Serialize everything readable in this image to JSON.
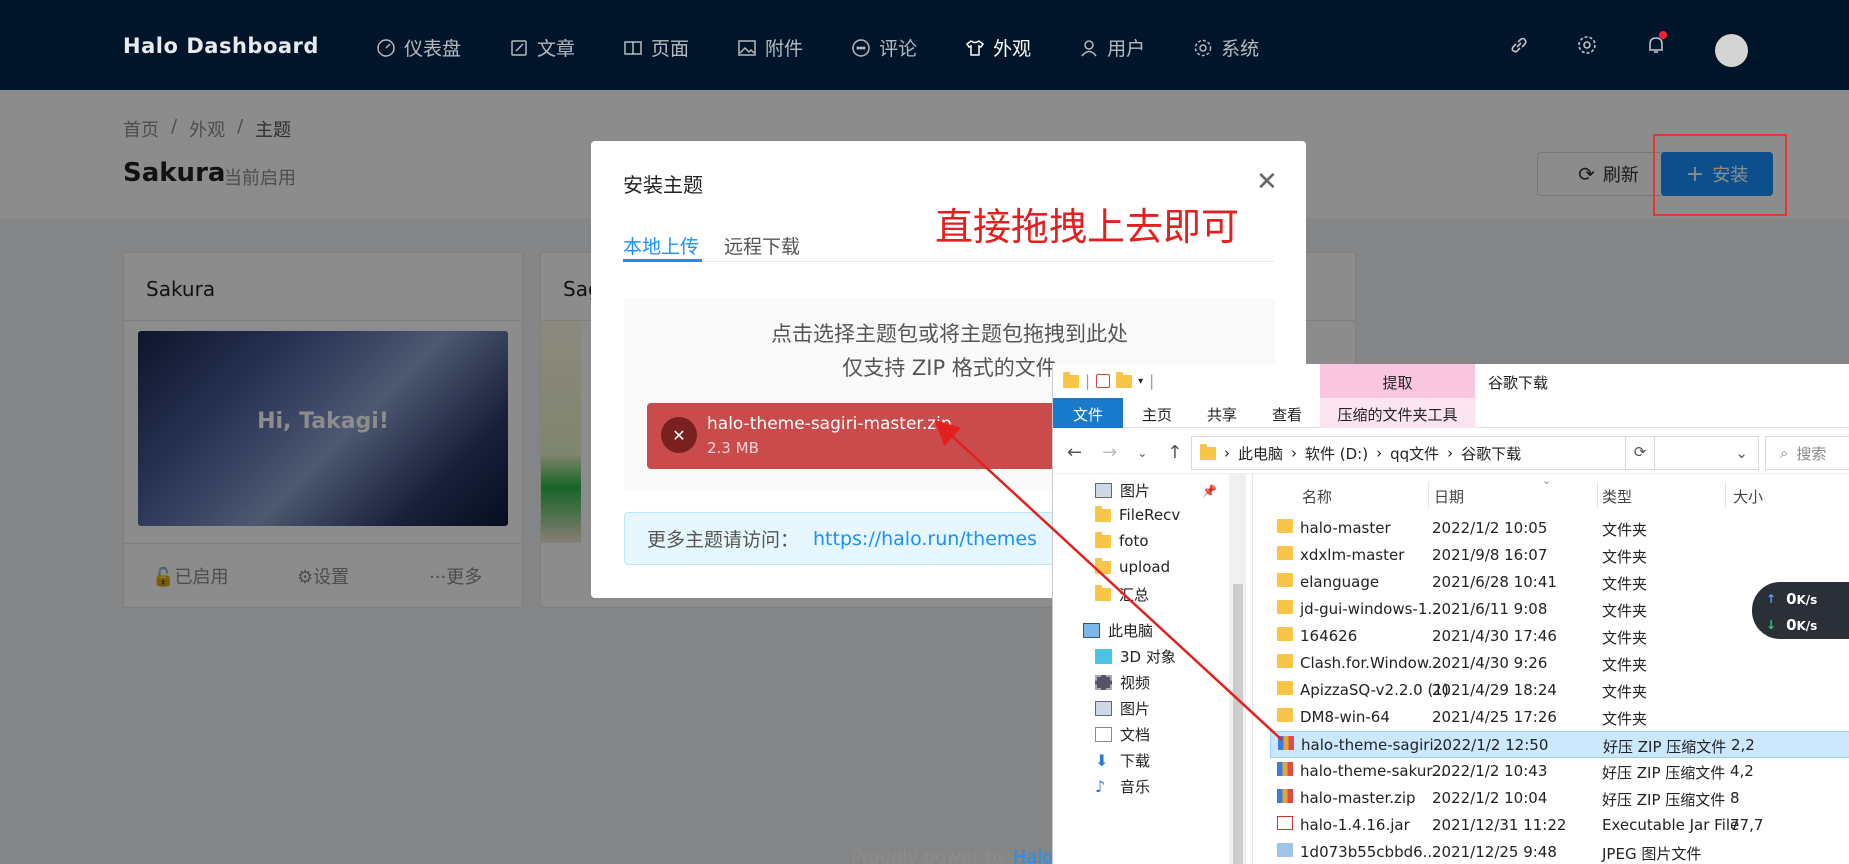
{
  "nav": {
    "brand_a": "Halo",
    "brand_b": "Dashboard",
    "items": [
      {
        "label": "仪表盘",
        "icon": "dashboard-icon"
      },
      {
        "label": "文章",
        "icon": "edit-icon"
      },
      {
        "label": "页面",
        "icon": "book-icon"
      },
      {
        "label": "附件",
        "icon": "picture-icon"
      },
      {
        "label": "评论",
        "icon": "comment-icon"
      },
      {
        "label": "外观",
        "icon": "skin-icon"
      },
      {
        "label": "用户",
        "icon": "user-icon"
      },
      {
        "label": "系统",
        "icon": "setting-icon"
      }
    ]
  },
  "breadcrumb": [
    "首页",
    "/",
    "外观",
    "/",
    "主题"
  ],
  "page": {
    "title": "Sakura",
    "subtitle": "当前启用",
    "refresh": "刷新",
    "install": "安装"
  },
  "cards": [
    {
      "title": "Sakura",
      "thumb_text": "Hi, Takagi!",
      "enabled": "已启用",
      "settings": "设置",
      "more": "更多"
    },
    {
      "title": "Sag"
    }
  ],
  "modal": {
    "title": "安装主题",
    "tab_local": "本地上传",
    "tab_remote": "远程下载",
    "hint1": "点击选择主题包或将主题包拖拽到此处",
    "hint2": "仅支持 ZIP 格式的文件",
    "file_name": "halo-theme-sagiri-master.zip",
    "file_size": "2.3 MB",
    "more_label": "更多主题请访问：",
    "more_link": "https://halo.run/themes"
  },
  "annotation": "直接拖拽上去即可",
  "footer": {
    "text": "Proudly power by ",
    "link": "Halo"
  },
  "explorer": {
    "ribbon_extract": "提取",
    "window_title": "谷歌下载",
    "tabs": [
      "文件",
      "主页",
      "共享",
      "查看",
      "压缩的文件夹工具"
    ],
    "path": [
      "此电脑",
      "软件 (D:)",
      "qq文件",
      "谷歌下载"
    ],
    "search_placeholder": "搜索",
    "nav_pane": [
      "图片",
      "FileRecv",
      "foto",
      "upload",
      "汇总",
      "此电脑",
      "3D 对象",
      "视频",
      "图片",
      "文档",
      "下载",
      "音乐"
    ],
    "headers": [
      "名称",
      "日期",
      "类型",
      "大小"
    ],
    "rows": [
      {
        "name": "halo-master",
        "date": "2022/1/2 10:05",
        "type": "文件夹",
        "size": "",
        "kind": "folder"
      },
      {
        "name": "xdxlm-master",
        "date": "2021/9/8 16:07",
        "type": "文件夹",
        "size": "",
        "kind": "folder"
      },
      {
        "name": "elanguage",
        "date": "2021/6/28 10:41",
        "type": "文件夹",
        "size": "",
        "kind": "folder"
      },
      {
        "name": "jd-gui-windows-1...",
        "date": "2021/6/11 9:08",
        "type": "文件夹",
        "size": "",
        "kind": "folder"
      },
      {
        "name": "164626",
        "date": "2021/4/30 17:46",
        "type": "文件夹",
        "size": "",
        "kind": "folder"
      },
      {
        "name": "Clash.for.Window...",
        "date": "2021/4/30 9:26",
        "type": "文件夹",
        "size": "",
        "kind": "folder"
      },
      {
        "name": "ApizzaSQ-v2.2.0 (1)",
        "date": "2021/4/29 18:24",
        "type": "文件夹",
        "size": "",
        "kind": "folder"
      },
      {
        "name": "DM8-win-64",
        "date": "2021/4/25 17:26",
        "type": "文件夹",
        "size": "",
        "kind": "folder"
      },
      {
        "name": "halo-theme-sagiri...",
        "date": "2022/1/2 12:50",
        "type": "好压 ZIP 压缩文件",
        "size": "2,2",
        "kind": "zip"
      },
      {
        "name": "halo-theme-sakur...",
        "date": "2022/1/2 10:43",
        "type": "好压 ZIP 压缩文件",
        "size": "4,2",
        "kind": "zip"
      },
      {
        "name": "halo-master.zip",
        "date": "2022/1/2 10:04",
        "type": "好压 ZIP 压缩文件",
        "size": "8",
        "kind": "zip"
      },
      {
        "name": "halo-1.4.16.jar",
        "date": "2021/12/31 11:22",
        "type": "Executable Jar File",
        "size": "77,7",
        "kind": "jar"
      },
      {
        "name": "1d073b55cbbd6...",
        "date": "2021/12/25 9:48",
        "type": "JPEG 图片文件",
        "size": "",
        "kind": "img"
      }
    ]
  },
  "net_widget": {
    "up": "0",
    "down": "0",
    "unit": "K/s"
  }
}
